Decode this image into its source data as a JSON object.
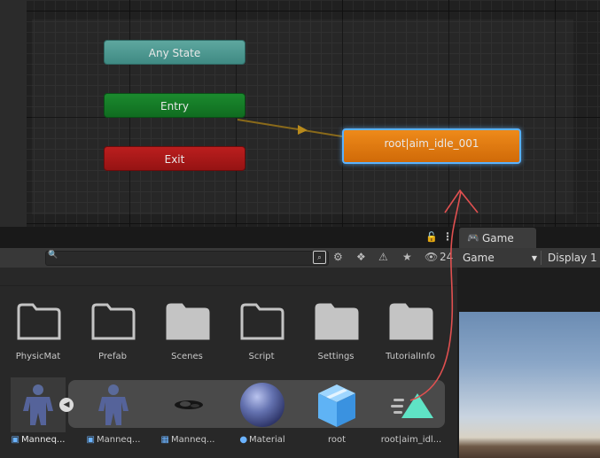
{
  "animator": {
    "states": {
      "any_state": "Any State",
      "entry": "Entry",
      "exit": "Exit",
      "default_state": "root|aim_idle_001"
    }
  },
  "game_tab": {
    "label": "Game",
    "icon": "gamepad-icon",
    "display_mode": "Game",
    "display": "Display 1"
  },
  "project": {
    "search": {
      "value": "",
      "placeholder": ""
    },
    "hidden_count": "24",
    "folders": [
      {
        "label": "PhysicMat",
        "icon": "folder-icon"
      },
      {
        "label": "Prefab",
        "icon": "folder-icon"
      },
      {
        "label": "Scenes",
        "icon": "folder-icon"
      },
      {
        "label": "Script",
        "icon": "folder-icon"
      },
      {
        "label": "Settings",
        "icon": "folder-icon"
      },
      {
        "label": "TutorialInfo",
        "icon": "folder-icon"
      }
    ],
    "assets": [
      {
        "label": "Manneq...",
        "type_icon": "prefab-icon"
      },
      {
        "label": "Manneq...",
        "type_icon": "prefab-icon"
      },
      {
        "label": "Manneq...",
        "type_icon": "mesh-icon"
      },
      {
        "label": "Material",
        "type_icon": "material-icon"
      },
      {
        "label": "root",
        "type_icon": ""
      },
      {
        "label": "root|aim_idl...",
        "type_icon": ""
      }
    ]
  },
  "colors": {
    "any_state": "#4f998f",
    "entry": "#14792a",
    "exit": "#a61a1a",
    "default_state": "#e07b10",
    "selection_outline": "#5ab2ff",
    "scribble": "#e05050"
  }
}
